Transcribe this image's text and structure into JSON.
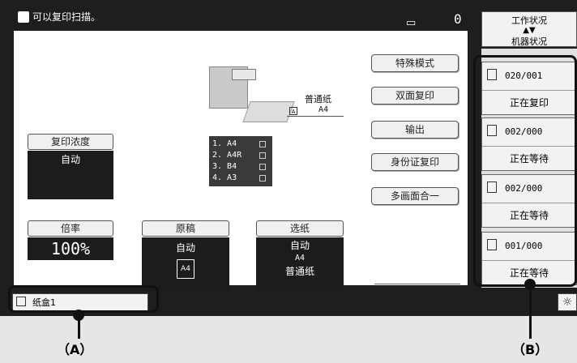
{
  "header": {
    "status": "可以复印扫描。",
    "count": "0"
  },
  "work_panel": {
    "title": "工作状况",
    "subtitle": "机器状况"
  },
  "side_buttons": [
    "特殊模式",
    "双面复印",
    "输出",
    "身份证复印",
    "多画面合一"
  ],
  "exposure": {
    "label": "复印浓度",
    "value": "自动"
  },
  "ratio": {
    "label": "倍率",
    "value": "100%"
  },
  "original": {
    "label": "原稿",
    "value": "自动",
    "size": "A4"
  },
  "paper_select": {
    "label": "选纸",
    "value": "自动",
    "size": "A4",
    "type": "普通纸"
  },
  "machine_preview": {
    "paper_type": "普通纸",
    "paper_size": "A4",
    "trays": [
      "1.  A4",
      "2.  A4R",
      "3.  B4",
      "4.  A3"
    ]
  },
  "jobs": [
    {
      "count": "020/001",
      "status": "正在复印"
    },
    {
      "count": "002/000",
      "status": "正在等待"
    },
    {
      "count": "002/000",
      "status": "正在等待"
    },
    {
      "count": "001/000",
      "status": "正在等待"
    }
  ],
  "tray_bar": {
    "label": "纸盒1"
  },
  "callouts": {
    "a": "（A）",
    "b": "（B）"
  }
}
